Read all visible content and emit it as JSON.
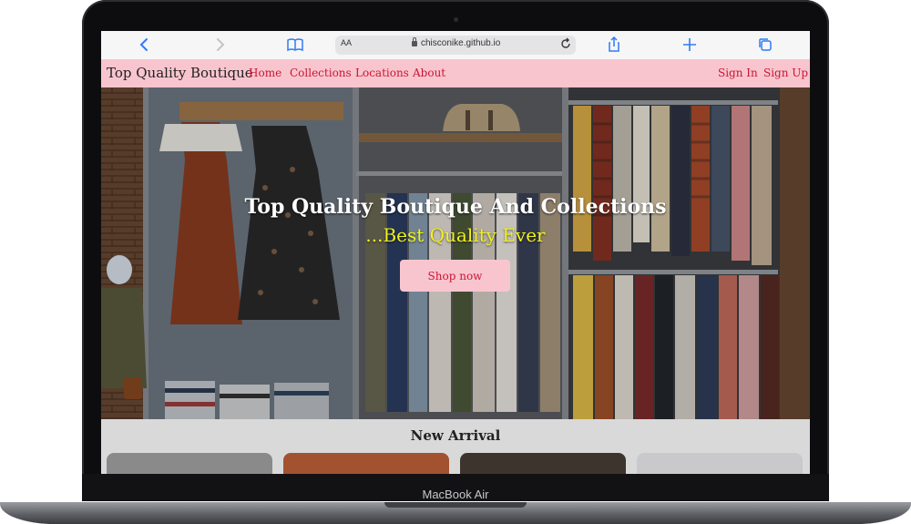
{
  "device": {
    "model_label": "MacBook Air"
  },
  "browser": {
    "text_size_label": "AA",
    "url": "chisconike.github.io",
    "icons": {
      "back": "chevron-left-icon",
      "forward": "chevron-right-icon",
      "bookmarks": "book-icon",
      "lock": "lock-icon",
      "reload": "reload-icon",
      "share": "share-icon",
      "new_tab": "plus-icon",
      "tabs": "tabs-icon"
    },
    "accent_color": "#2f7cf6"
  },
  "site": {
    "brand": "Top Quality Boutique",
    "nav_left": [
      "Home",
      "Collections",
      "Locations",
      "About"
    ],
    "nav_right": [
      "Sign In",
      "Sign Up"
    ],
    "nav_bg_color": "#f8c5cf",
    "link_color": "#cc1530"
  },
  "hero": {
    "title": "Top Quality Boutique And Collections",
    "subtitle": "...Best Quality Ever",
    "cta_label": "Shop now",
    "subtitle_color": "#f2f21a"
  },
  "arrivals": {
    "title": "New Arrival"
  }
}
